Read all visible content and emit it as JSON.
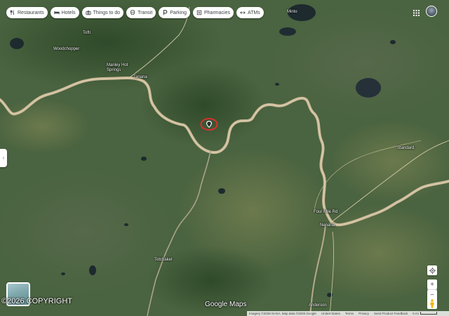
{
  "toolbar": {
    "chips": [
      {
        "label": "Restaurants",
        "icon": "fork-knife-icon"
      },
      {
        "label": "Hotels",
        "icon": "bed-icon"
      },
      {
        "label": "Things to do",
        "icon": "camera-icon"
      },
      {
        "label": "Transit",
        "icon": "train-icon"
      },
      {
        "label": "Parking",
        "icon": "parking-icon"
      },
      {
        "label": "Pharmacies",
        "icon": "pharmacy-icon"
      },
      {
        "label": "ATMs",
        "icon": "atm-icon"
      }
    ]
  },
  "header": {
    "apps_icon": "grid-apps-icon",
    "avatar_icon": "account-avatar"
  },
  "map": {
    "view": "satellite",
    "marker_icon": "location-marker-icon",
    "highlight_color": "#d9302c",
    "river_color": "#c9b896",
    "places": [
      {
        "name": "Minto"
      },
      {
        "name": "Tofti"
      },
      {
        "name": "Woodchopper"
      },
      {
        "name": "Manley Hot Springs"
      },
      {
        "name": "Tanana"
      },
      {
        "name": "Standard"
      },
      {
        "name": "Four Mile Rd"
      },
      {
        "name": "Nenana"
      },
      {
        "name": "Totchaket"
      },
      {
        "name": "Anderson"
      }
    ]
  },
  "overlay": {
    "copyright_watermark": "©2026 COPYRIGHT",
    "logo": "Google Maps"
  },
  "controls": {
    "collapse_icon": "chevron-left-icon",
    "collapse_glyph": "‹",
    "location_icon": "my-location-icon",
    "zoom_in": "+",
    "zoom_out": "−",
    "pegman_icon": "pegman-icon"
  },
  "footer": {
    "imagery": "Imagery ©2026 NASA, Map data ©2026 Google",
    "country": "United States",
    "terms": "Terms",
    "privacy": "Privacy",
    "feedback": "Send Product Feedback",
    "scale": "5 mi"
  }
}
